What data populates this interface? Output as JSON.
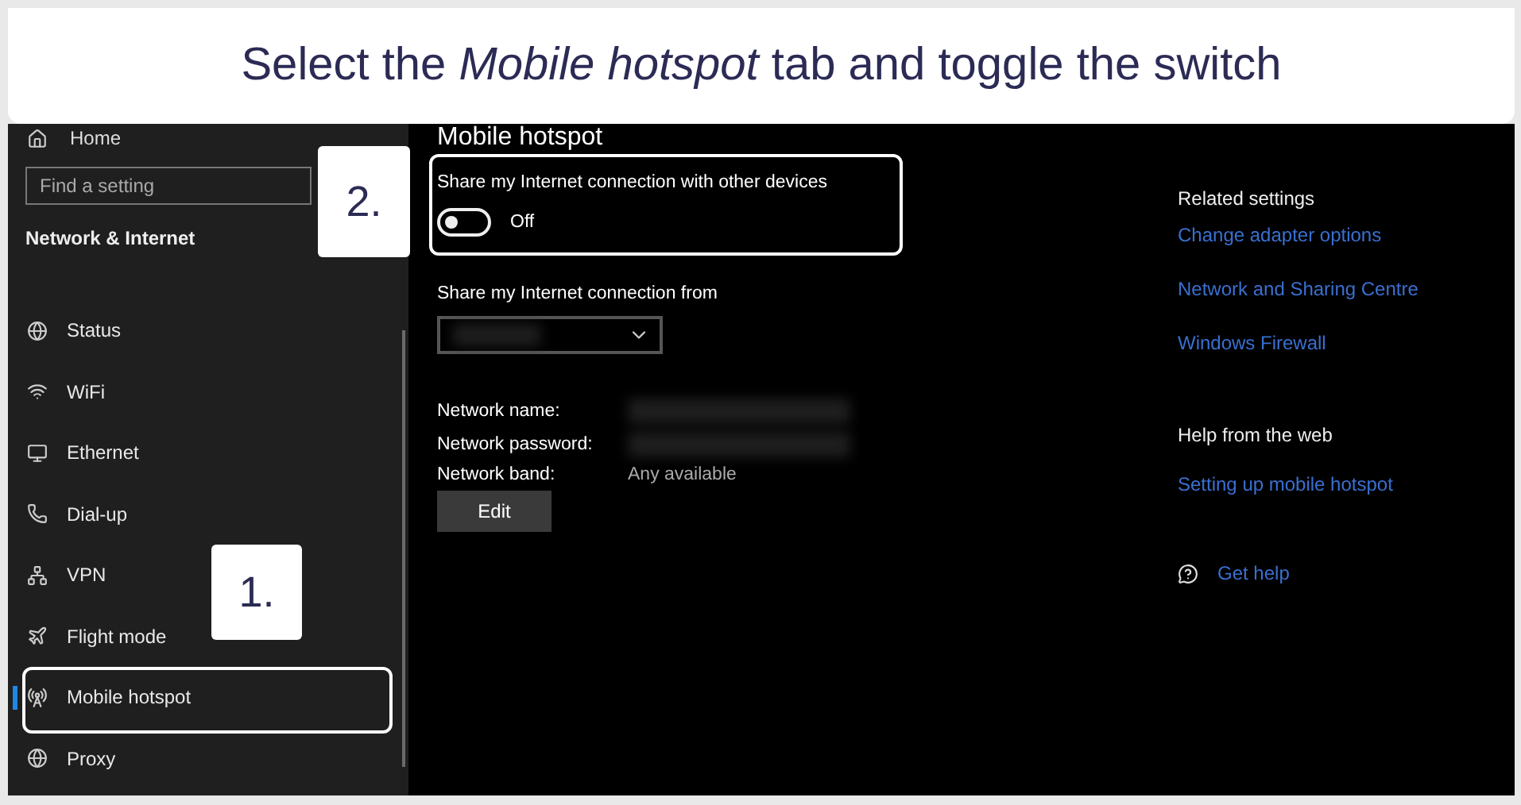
{
  "banner": {
    "text": "Select the *Mobile hotspot* tab and toggle the switch"
  },
  "sidebar": {
    "home": "Home",
    "search": {
      "placeholder": "Find a setting"
    },
    "section": "Network & Internet",
    "items": [
      {
        "label": "Status",
        "selected": false
      },
      {
        "label": "WiFi",
        "selected": false
      },
      {
        "label": "Ethernet",
        "selected": false
      },
      {
        "label": "Dial-up",
        "selected": false
      },
      {
        "label": "VPN",
        "selected": false
      },
      {
        "label": "Flight mode",
        "selected": false
      },
      {
        "label": "Mobile hotspot",
        "selected": true
      },
      {
        "label": "Proxy",
        "selected": false
      }
    ]
  },
  "page": {
    "title": "Mobile hotspot",
    "share_toggle": {
      "label": "Share my Internet connection with other devices",
      "on": false,
      "state_text": "Off"
    },
    "share_from": {
      "label": "Share my Internet connection from",
      "redacted": true
    },
    "properties": [
      {
        "label": "Network name:",
        "redacted": true
      },
      {
        "label": "Network password:",
        "redacted": true
      },
      {
        "label": "Network band:",
        "redacted": false,
        "value": "Any available"
      }
    ],
    "edit_button": "Edit"
  },
  "related": {
    "heading": "Related settings",
    "links": [
      "Change adapter options",
      "Network and Sharing Centre",
      "Windows Firewall"
    ]
  },
  "help": {
    "heading": "Help from the web",
    "links": [
      "Setting up mobile hotspot"
    ],
    "get_help": "Get help"
  },
  "callouts": [
    {
      "number": "1."
    },
    {
      "number": "2."
    }
  ]
}
